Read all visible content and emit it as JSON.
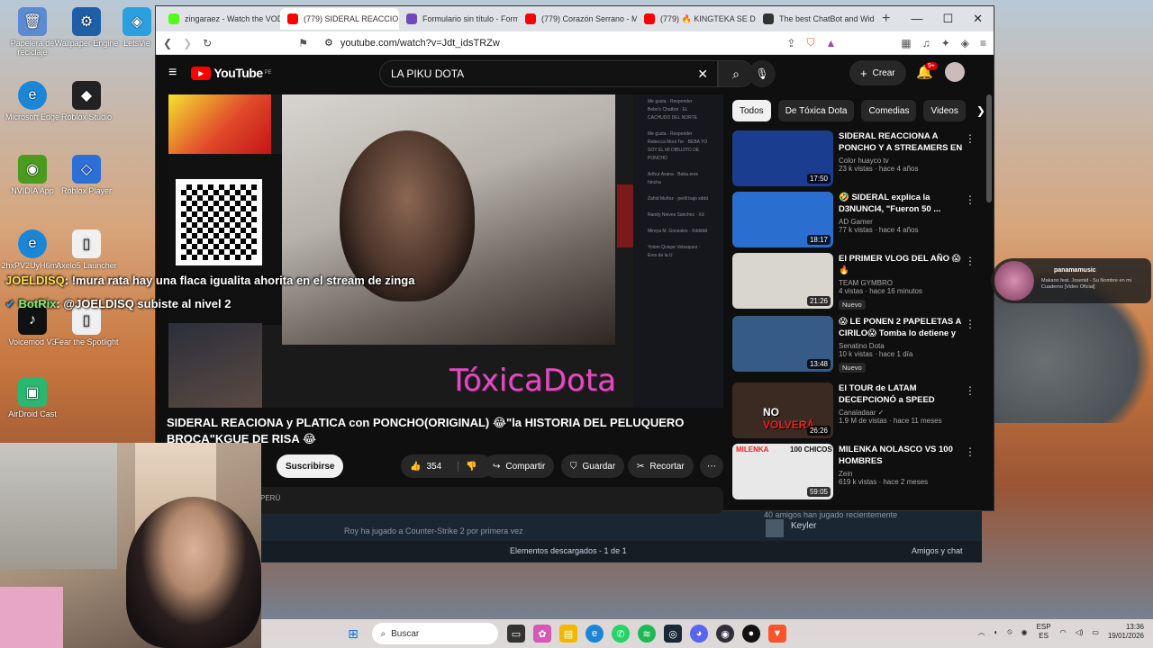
{
  "desktop": {
    "icons": [
      {
        "label": "Papelera de reciclaje",
        "icon": "recycle-bin-icon",
        "color": "#5b8bd0"
      },
      {
        "label": "Wallpaper Engine",
        "icon": "wallpaper-engine-icon",
        "color": "#1f5fa8"
      },
      {
        "label": "LetsVie",
        "icon": "letsview-icon",
        "color": "#2ba0e0"
      },
      {
        "label": "Microsoft Edge",
        "icon": "edge-icon",
        "color": "#1c86d6"
      },
      {
        "label": "Roblox Studio",
        "icon": "roblox-studio-icon",
        "color": "#222"
      },
      {
        "label": "NVIDIA App",
        "icon": "nvidia-icon",
        "color": "#4a9c1f"
      },
      {
        "label": "Roblox Player",
        "icon": "roblox-player-icon",
        "color": "#2d6fd6"
      },
      {
        "label": "Voicemod V3",
        "icon": "voicemod-icon",
        "color": "#111"
      },
      {
        "label": "Fear the Spotlight",
        "icon": "game-icon",
        "color": "#444"
      },
      {
        "label": "AirDroid Cast",
        "icon": "airdroid-icon",
        "color": "#2bb673"
      }
    ],
    "partial_labels": [
      "2hxPV2UyH6m...",
      "Axelo5 Launcher"
    ]
  },
  "chat_overlay": [
    {
      "user": "JOELDISQ",
      "sep": ":",
      "text": "!mura rata hay una flaca igualita ahorita en el stream de zinga",
      "color": "#ffe14d"
    },
    {
      "user": "BotRix",
      "sep": ":",
      "text": "@JOELDISQ subiste al nivel 2",
      "color": "#7cf27c"
    }
  ],
  "browser": {
    "tabs": [
      {
        "title": "zingaraez - Watch the VOD",
        "color": "#53fc18",
        "active": false
      },
      {
        "title": "(779) SIDERAL REACCIONA",
        "color": "#ff0000",
        "active": true
      },
      {
        "title": "Formulario sin título - Form",
        "color": "#7248b9",
        "active": false
      },
      {
        "title": "(779) Corazón Serrano - Mi",
        "color": "#ff0000",
        "active": false
      },
      {
        "title": "(779) 🔥 KINGTEKA SE DISC",
        "color": "#ff0000",
        "active": false
      },
      {
        "title": "The best ChatBot and Widge",
        "color": "#333333",
        "active": false
      }
    ],
    "new_tab": "+",
    "url": "youtube.com/watch?v=Jdt_idsTRZw"
  },
  "youtube": {
    "logo_text": "YouTube",
    "region": "PE",
    "search_value": "LA PIKU DOTA",
    "create_label": "Crear",
    "notif_count": "9+",
    "video_title": "SIDERAL REACIONA y PLATICA con PONCHO(ORIGINAL) 😂\"la HISTORIA DEL PELUQUERO BROCA\"KGUE DE RISA 😂",
    "watermark": "TóxicaDota",
    "subscribe_label": "Suscribirse",
    "like_count": "354",
    "share_label": "Compartir",
    "save_label": "Guardar",
    "clip_label": "Recortar",
    "chips": [
      "Todos",
      "De Tóxica Dota",
      "Comedias",
      "Videos"
    ],
    "recommendations": [
      {
        "title": "SIDERAL REACCIONA A PONCHO Y A STREAMERS EN ...",
        "channel": "Color huayco tv",
        "views": "23 k vistas · hace 4 años",
        "duration": "17:50",
        "new": false,
        "thumb": "#1b3d8f"
      },
      {
        "title": "🤣 SIDERAL explica la D3NUNCI4, \"Fueron 50 ...",
        "channel": "AD Gamer",
        "views": "77 k vistas · hace 4 años",
        "duration": "18:17",
        "new": false,
        "thumb": "#2a6fcf"
      },
      {
        "title": "El PRIMER VLOG DEL AÑO 😱 🔥",
        "channel": "TEAM GYMBRO",
        "views": "4 vistas · hace 16 minutos",
        "duration": "21:26",
        "new": true,
        "thumb": "#d9d6cf"
      },
      {
        "title": "😱 LE PONEN 2 PAPELETAS A CIRILO😱 Tomba lo detiene y ...",
        "channel": "Senatino Dota",
        "views": "10 k vistas · hace 1 día",
        "duration": "13:48",
        "new": true,
        "thumb": "#355b86"
      },
      {
        "title": "El TOUR de LATAM DECEPCIONÓ a SPEED",
        "channel": "Canaladaar ✓",
        "views": "1.9 M de vistas · hace 11 meses",
        "duration": "26:26",
        "new": false,
        "thumb": "#3a2a22"
      },
      {
        "title": "MILENKA NOLASCO VS 100 HOMBRES",
        "channel": "Zein",
        "views": "619 k vistas · hace 2 meses",
        "duration": "59:05",
        "new": false,
        "thumb": "#e8e8e8"
      }
    ],
    "comment_peek": "PERÚ"
  },
  "steam": {
    "activity": "Roy ha jugado a  Counter-Strike 2 por primera vez",
    "friends_played": "40 amigos han jugado recientemente",
    "friend_name": "Keyler",
    "downloads": "Elementos descargados - 1 de 1",
    "friends_chat": "Amigos y chat"
  },
  "spotlight_overlay": {
    "artist": "panamamusic",
    "song": "Makano feat. Josenid - Su Nombre en mi Cuaderno [Video Oficial]"
  },
  "taskbar": {
    "search_placeholder": "Buscar",
    "lang": "ESP",
    "lang2": "ES",
    "time": "13:36",
    "date": "19/01/2026"
  }
}
